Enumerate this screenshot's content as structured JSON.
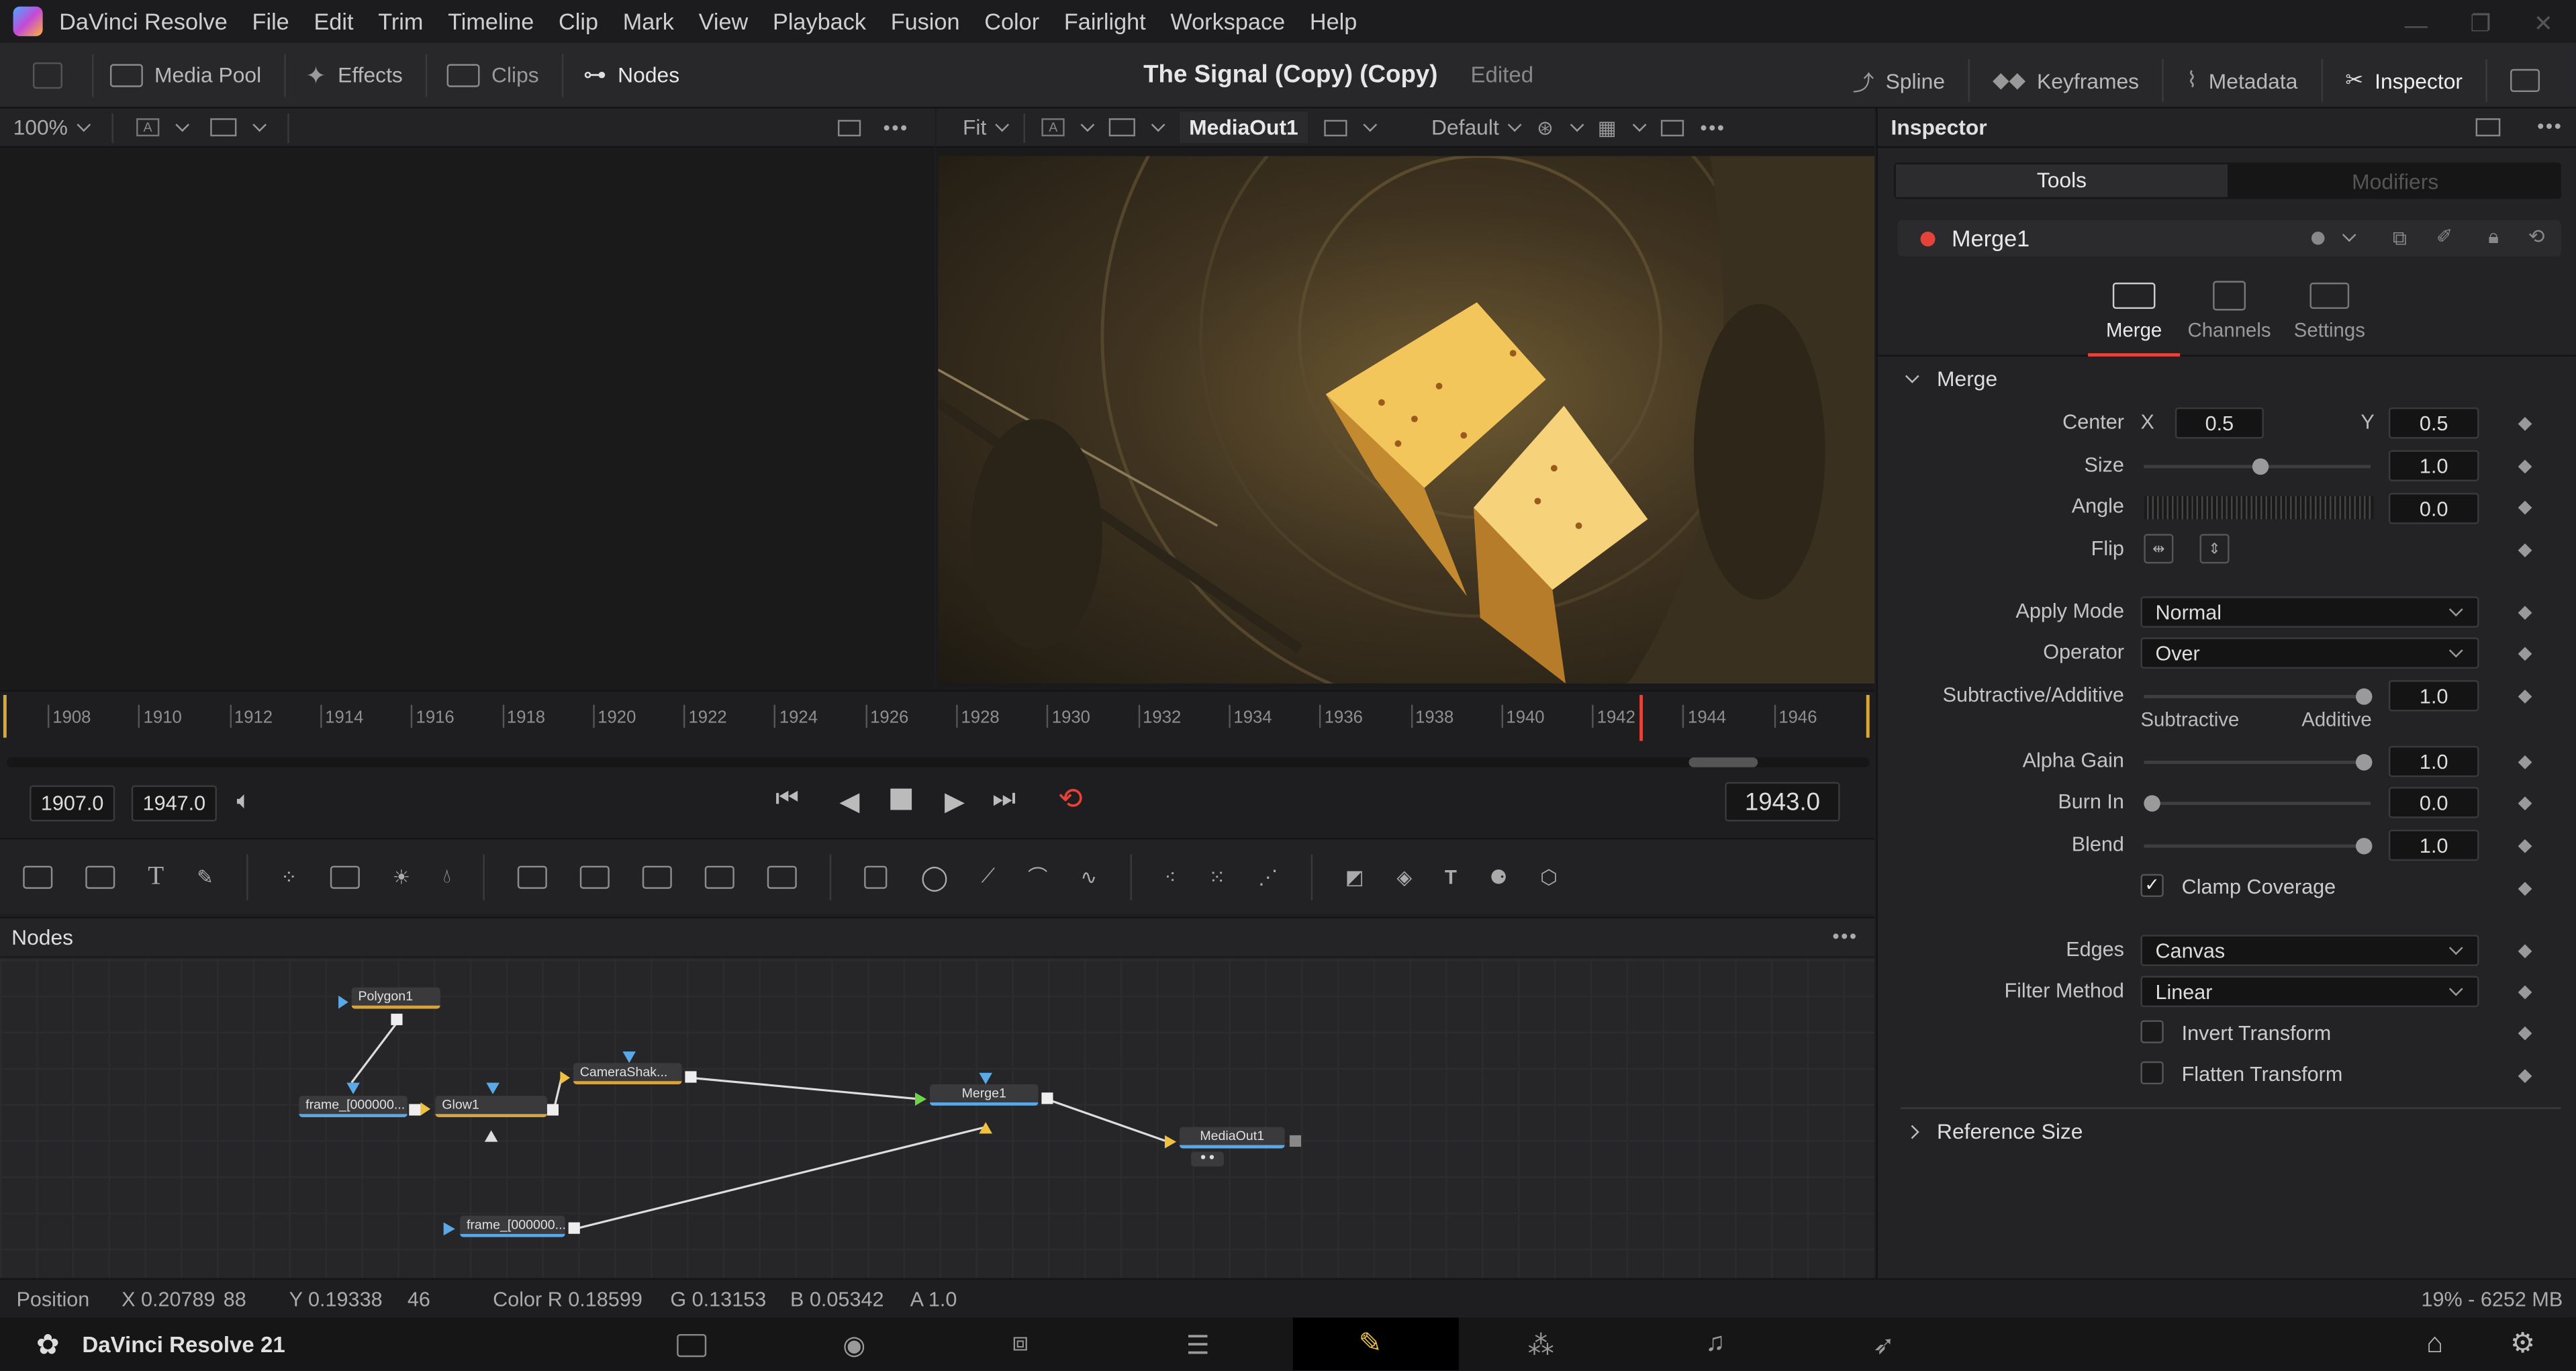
{
  "menubar": {
    "app_name": "DaVinci Resolve",
    "items": [
      "File",
      "Edit",
      "Trim",
      "Timeline",
      "Clip",
      "Mark",
      "View",
      "Playback",
      "Fusion",
      "Color",
      "Fairlight",
      "Workspace",
      "Help"
    ]
  },
  "toolbar": {
    "media_pool": "Media Pool",
    "effects": "Effects",
    "clips": "Clips",
    "nodes": "Nodes",
    "project_title": "The Signal (Copy) (Copy)",
    "status": "Edited",
    "spline": "Spline",
    "keyframes": "Keyframes",
    "metadata": "Metadata",
    "inspector": "Inspector"
  },
  "viewer_left": {
    "zoom": "100%",
    "label_a": "A"
  },
  "viewer_right": {
    "fit": "Fit",
    "label_a": "A",
    "output": "MediaOut1",
    "lut": "Default"
  },
  "timeline": {
    "ticks": [
      "1908",
      "1910",
      "1912",
      "1914",
      "1916",
      "1918",
      "1920",
      "1922",
      "1924",
      "1926",
      "1928",
      "1930",
      "1932",
      "1934",
      "1936",
      "1938",
      "1940",
      "1942",
      "1944",
      "1946"
    ],
    "start": "1907.0",
    "end": "1947.0",
    "current": "1943.0"
  },
  "nodes_panel": {
    "title": "Nodes",
    "nodes": {
      "polygon": "Polygon1",
      "frame1": "frame_[000000...",
      "glow": "Glow1",
      "camerashake": "CameraShak...",
      "merge": "Merge1",
      "mediaout": "MediaOut1",
      "frame2": "frame_[000000..."
    }
  },
  "inspector": {
    "title": "Inspector",
    "tab_tools": "Tools",
    "tab_modifiers": "Modifiers",
    "node_name": "Merge1",
    "subtabs": [
      "Merge",
      "Channels",
      "Settings"
    ],
    "section": "Merge",
    "center_label": "Center",
    "x_label": "X",
    "center_x": "0.5",
    "y_label": "Y",
    "center_y": "0.5",
    "size_label": "Size",
    "size": "1.0",
    "angle_label": "Angle",
    "angle": "0.0",
    "flip_label": "Flip",
    "apply_mode_label": "Apply Mode",
    "apply_mode": "Normal",
    "operator_label": "Operator",
    "operator": "Over",
    "subadd_label": "Subtractive/Additive",
    "subadd": "1.0",
    "subtractive": "Subtractive",
    "additive": "Additive",
    "alpha_gain_label": "Alpha Gain",
    "alpha_gain": "1.0",
    "burn_in_label": "Burn In",
    "burn_in": "0.0",
    "blend_label": "Blend",
    "blend": "1.0",
    "clamp_coverage": "Clamp Coverage",
    "edges_label": "Edges",
    "edges": "Canvas",
    "filter_method_label": "Filter Method",
    "filter_method": "Linear",
    "invert_transform": "Invert Transform",
    "flatten_transform": "Flatten Transform",
    "reference_size": "Reference Size"
  },
  "statusbar": {
    "position_label": "Position",
    "x": "X 0.20789",
    "x_px": "88",
    "y": "Y 0.19338",
    "y_px": "46",
    "color_r": "Color R 0.18599",
    "color_g": "G 0.13153",
    "color_b": "B 0.05342",
    "alpha": "A 1.0",
    "memory": "19% - 6252 MB"
  },
  "pagebar": {
    "app_label": "DaVinci Resolve 21"
  },
  "colors": {
    "accent_red": "#e5433a",
    "node_orange": "#d6a33c",
    "node_blue": "#5aa9e6"
  }
}
